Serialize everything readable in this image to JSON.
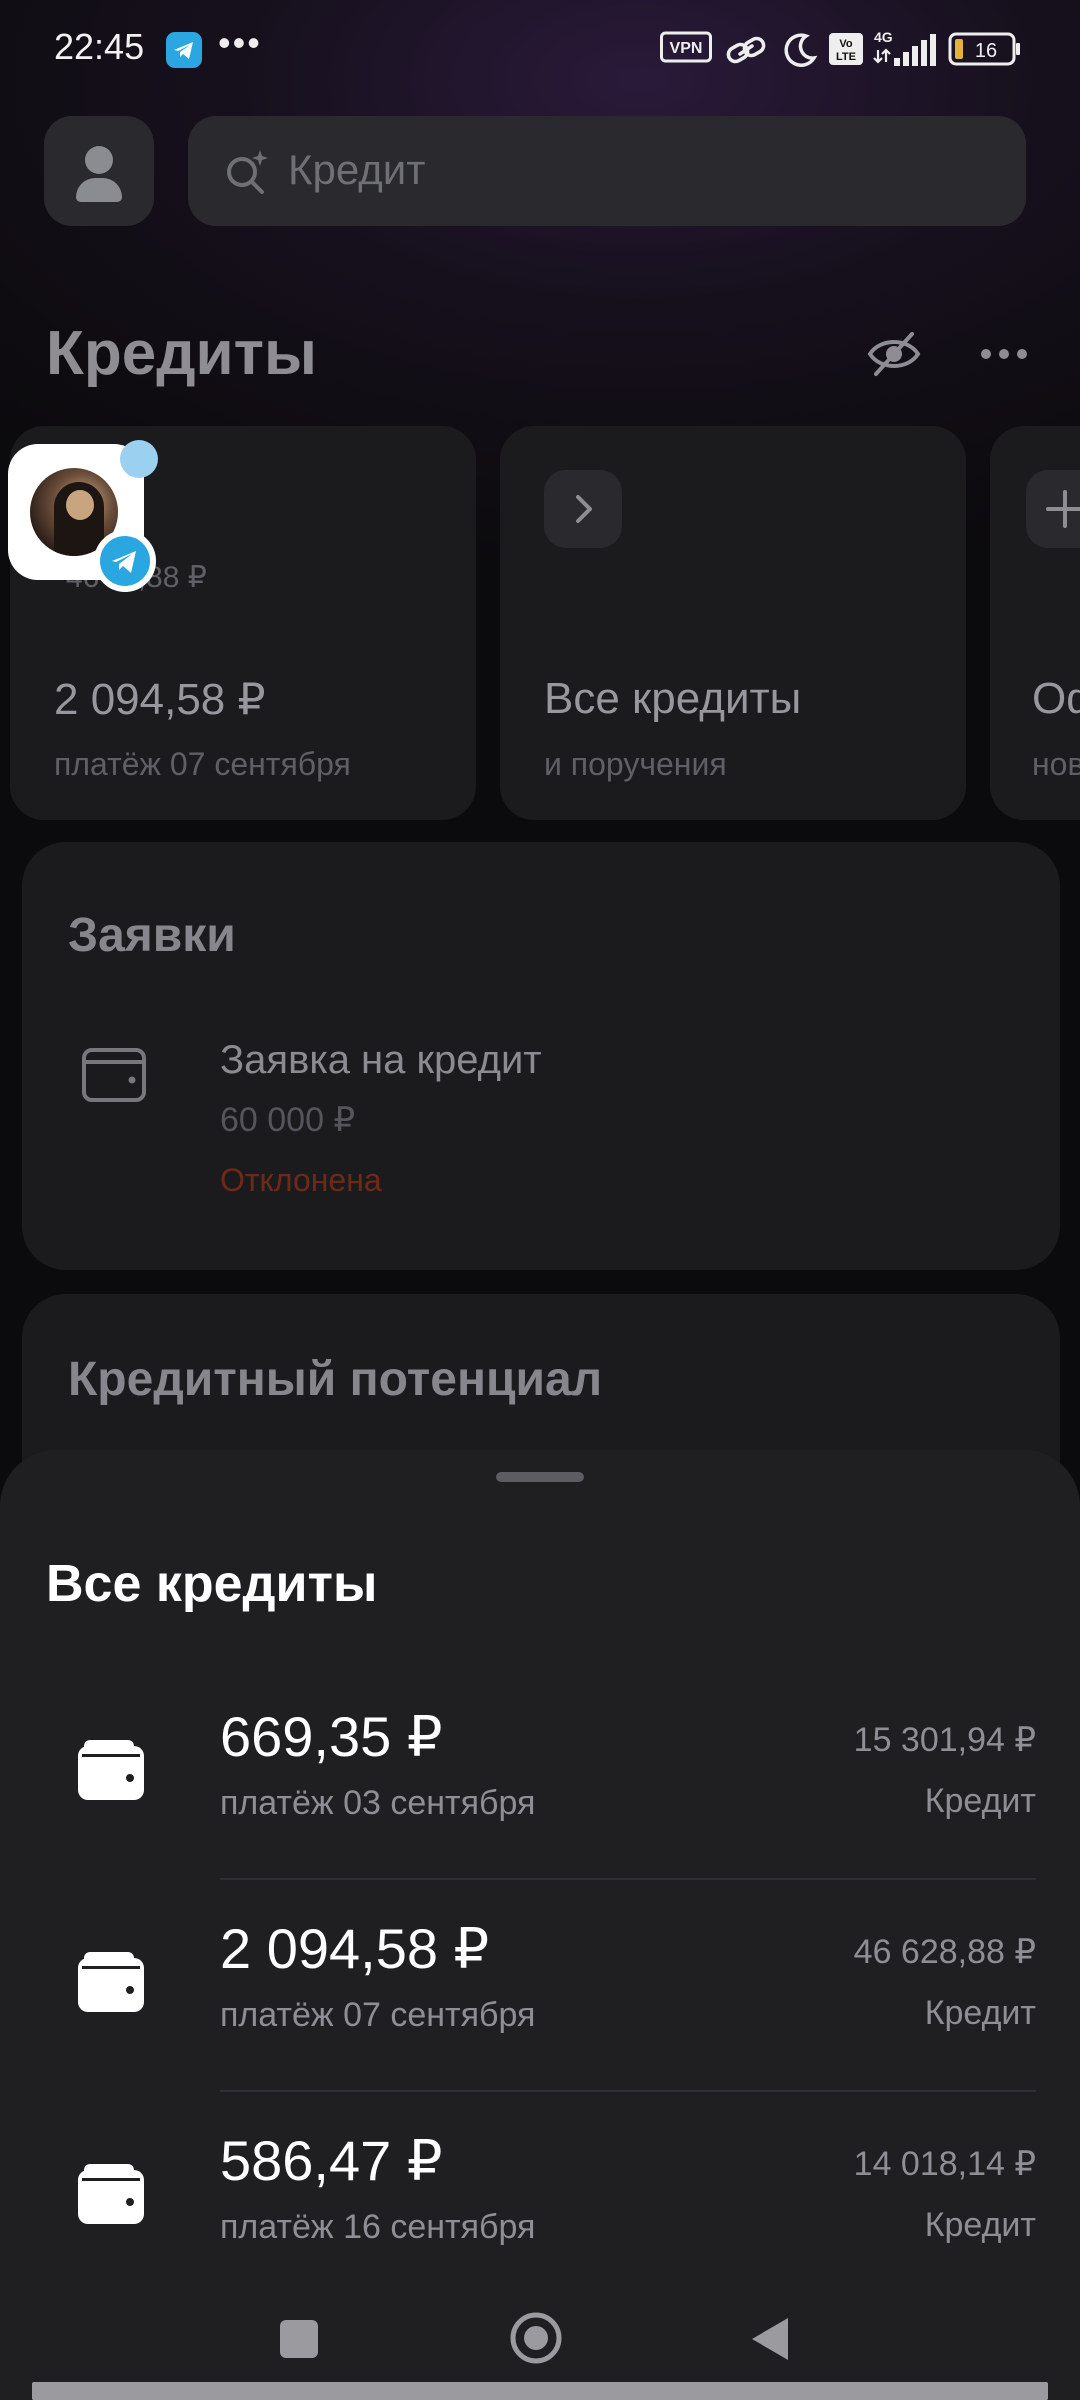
{
  "status_bar": {
    "time": "22:45",
    "overflow": "•••",
    "vpn": "VPN",
    "signal_label": "4G",
    "volte": "Vo LTE",
    "battery": "16"
  },
  "header": {
    "search_placeholder": "Кредит",
    "title": "Кредиты"
  },
  "cards": [
    {
      "masked": "46 ···,88 ₽",
      "amount": "2 094,58 ₽",
      "subtitle": "платёж 07 сентября"
    },
    {
      "title": "Все кредиты",
      "subtitle": "и поручения"
    },
    {
      "title": "Оф",
      "subtitle": "нов"
    }
  ],
  "applications": {
    "title": "Заявки",
    "item_title": "Заявка на кредит",
    "item_amount": "60 000 ₽",
    "item_status": "Отклонена"
  },
  "potential": {
    "title": "Кредитный потенциал"
  },
  "sheet": {
    "title": "Все кредиты",
    "loans": [
      {
        "payment": "669,35 ₽",
        "date": "платёж 03 сентября",
        "total": "15 301,94 ₽",
        "kind": "Кредит"
      },
      {
        "payment": "2 094,58 ₽",
        "date": "платёж 07 сентября",
        "total": "46 628,88 ₽",
        "kind": "Кредит"
      },
      {
        "payment": "586,47 ₽",
        "date": "платёж 16 сентября",
        "total": "14 018,14 ₽",
        "kind": "Кредит"
      }
    ]
  },
  "colors": {
    "accent_blue": "#2aa7e0",
    "rejected": "#6e2a17",
    "sheet_bg": "#1f1f22"
  }
}
